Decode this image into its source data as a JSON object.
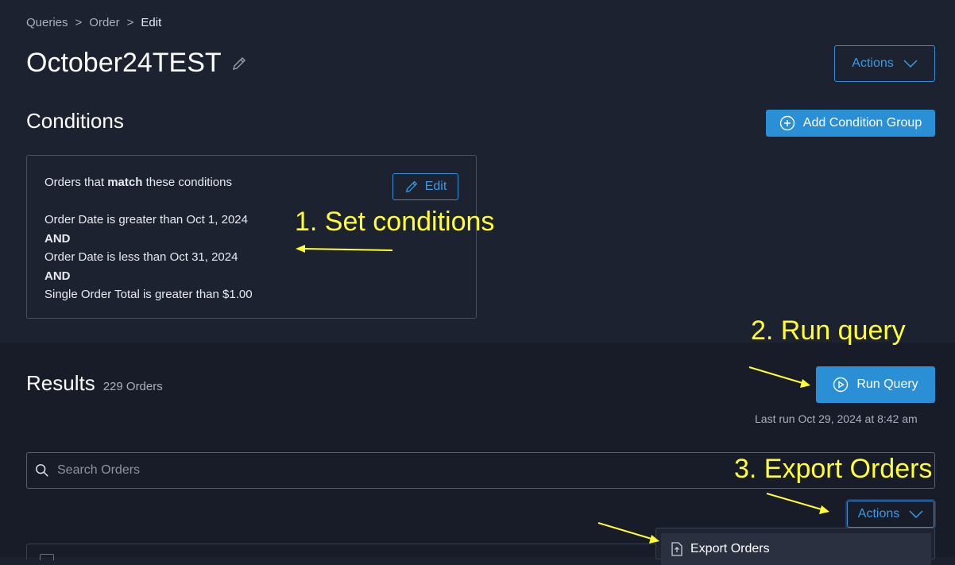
{
  "breadcrumb": {
    "items": [
      "Queries",
      "Order"
    ],
    "current": "Edit",
    "separator": ">"
  },
  "page": {
    "title": "October24TEST"
  },
  "header": {
    "actions_label": "Actions"
  },
  "conditions": {
    "title": "Conditions",
    "add_group_label": "Add Condition Group",
    "intro_prefix": "Orders that",
    "intro_bold": "match",
    "intro_suffix": "these conditions",
    "edit_label": "Edit",
    "lines": [
      "Order Date is greater than Oct 1, 2024",
      "AND",
      "Order Date is less than Oct 31, 2024",
      "AND",
      "Single Order Total is greater than $1.00"
    ]
  },
  "annotations": {
    "step1": "1. Set conditions",
    "step2": "2. Run query",
    "step3": "3. Export Orders"
  },
  "results": {
    "title": "Results",
    "count": "229 Orders",
    "run_label": "Run Query",
    "last_run": "Last run Oct 29, 2024 at 8:42 am",
    "search_placeholder": "Search Orders",
    "actions_label": "Actions",
    "menu": {
      "export_label": "Export Orders"
    }
  },
  "colors": {
    "accent": "#2b8fd6",
    "annotation": "#ffff33",
    "background": "#1d2231"
  }
}
